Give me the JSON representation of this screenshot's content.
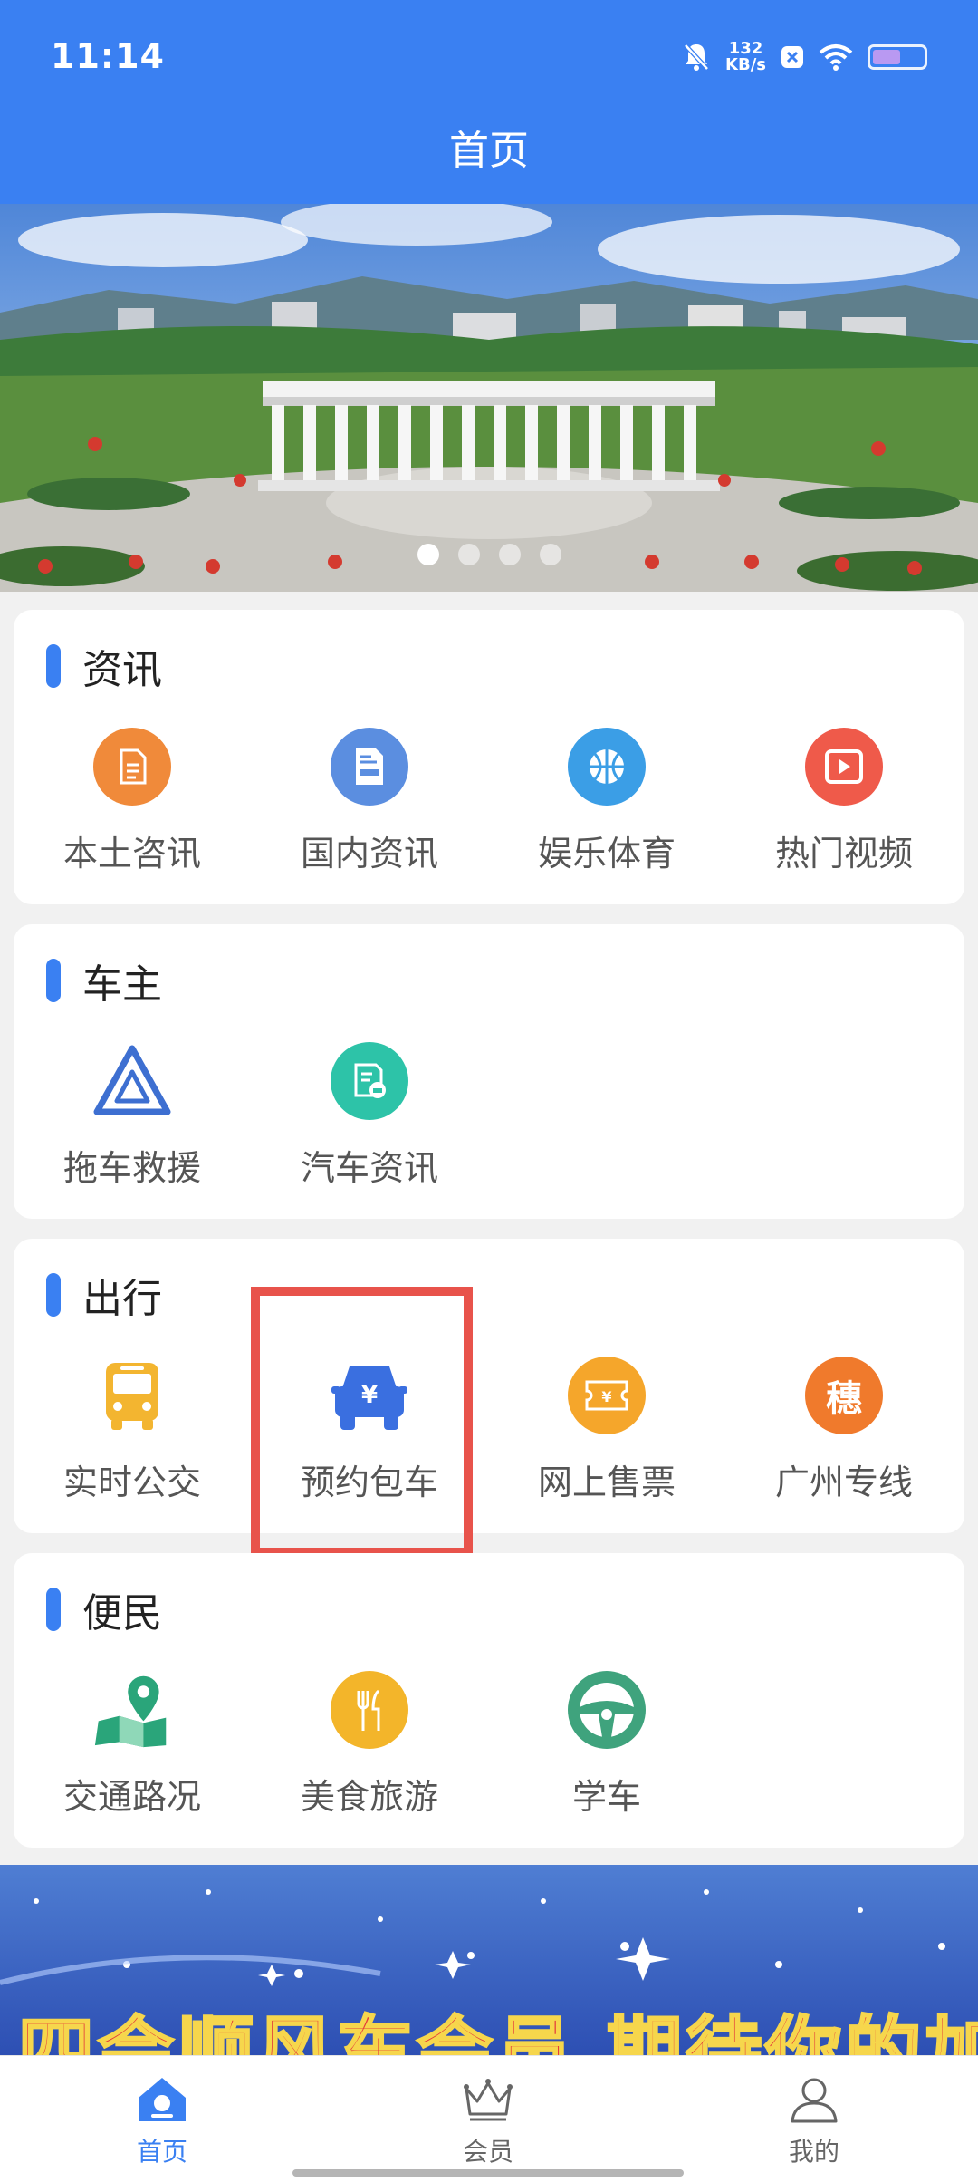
{
  "status_bar": {
    "time": "11:14",
    "speed_value": "132",
    "speed_unit": "KB/s"
  },
  "header": {
    "title": "首页"
  },
  "banner": {
    "slide_count": 4,
    "active_slide": 1
  },
  "sections": [
    {
      "title": "资讯",
      "items": [
        {
          "label": "本土咨讯",
          "icon": "document-icon",
          "color": "#f08a3a"
        },
        {
          "label": "国内资讯",
          "icon": "news-icon",
          "color": "#5b8ee0"
        },
        {
          "label": "娱乐体育",
          "icon": "basketball-icon",
          "color": "#3b9ee6"
        },
        {
          "label": "热门视频",
          "icon": "play-icon",
          "color": "#ef5a4a"
        }
      ]
    },
    {
      "title": "车主",
      "items": [
        {
          "label": "拖车救援",
          "icon": "warning-triangle-icon",
          "color": "#3d6fd1"
        },
        {
          "label": "汽车资讯",
          "icon": "car-news-icon",
          "color": "#2dc3a8"
        }
      ]
    },
    {
      "title": "出行",
      "items": [
        {
          "label": "实时公交",
          "icon": "bus-icon",
          "color": "#f3b530"
        },
        {
          "label": "预约包车",
          "icon": "car-yuan-icon",
          "color": "#3a6fe0"
        },
        {
          "label": "网上售票",
          "icon": "ticket-icon",
          "color": "#f5a62b"
        },
        {
          "label": "广州专线",
          "icon": "sui-badge-icon",
          "color": "#f07a2c",
          "glyph": "穗"
        }
      ]
    },
    {
      "title": "便民",
      "items": [
        {
          "label": "交通路况",
          "icon": "map-pin-icon",
          "color": "#2aa57a"
        },
        {
          "label": "美食旅游",
          "icon": "fork-knife-icon",
          "color": "#f3b52a"
        },
        {
          "label": "学车",
          "icon": "steering-wheel-icon",
          "color": "#3fa37d"
        }
      ]
    }
  ],
  "promo": {
    "text": "四会顺风车会员  期待你的加入"
  },
  "tabbar": {
    "items": [
      {
        "label": "首页",
        "icon": "home-icon",
        "active": true
      },
      {
        "label": "会员",
        "icon": "crown-icon",
        "active": false
      },
      {
        "label": "我的",
        "icon": "user-icon",
        "active": false
      }
    ]
  }
}
